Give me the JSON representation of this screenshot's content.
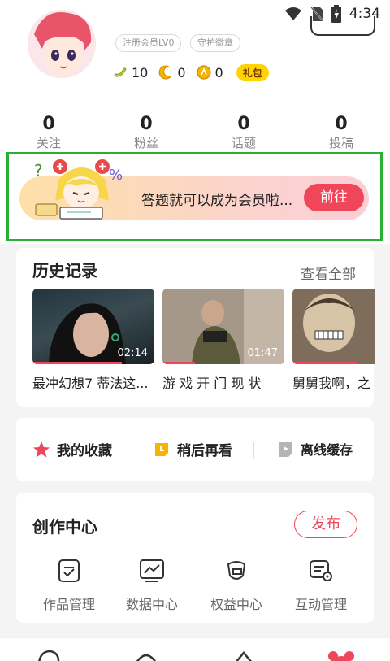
{
  "status_bar": {
    "time": "4:34"
  },
  "profile": {
    "tags": [
      "注册会员LV0",
      "守护徽章"
    ],
    "currencies": [
      {
        "icon": "banana-icon",
        "value": "10"
      },
      {
        "icon": "moon-icon",
        "value": "0"
      },
      {
        "icon": "coin-icon",
        "value": "0"
      }
    ],
    "gift_label": "礼包"
  },
  "stats": [
    {
      "value": "0",
      "label": "关注"
    },
    {
      "value": "0",
      "label": "粉丝"
    },
    {
      "value": "0",
      "label": "话题"
    },
    {
      "value": "0",
      "label": "投稿"
    }
  ],
  "banner": {
    "text": "答题就可以成为会员啦...",
    "button_label": "前往"
  },
  "history": {
    "title": "历史记录",
    "see_all": "查看全部",
    "videos": [
      {
        "title": "最冲幻想7 蒂法这...",
        "duration": "02:14"
      },
      {
        "title": "游 戏 开 门 现 状",
        "duration": "01:47"
      },
      {
        "title": "舅舅我啊，之",
        "duration": ""
      }
    ]
  },
  "quick_actions": [
    {
      "label": "我的收藏",
      "icon": "star-icon"
    },
    {
      "label": "稍后再看",
      "icon": "clock-icon"
    },
    {
      "label": "离线缓存",
      "icon": "download-icon"
    }
  ],
  "creation": {
    "title": "创作中心",
    "publish_label": "发布",
    "tools": [
      {
        "label": "作品管理",
        "icon": "works-icon"
      },
      {
        "label": "数据中心",
        "icon": "chart-icon"
      },
      {
        "label": "权益中心",
        "icon": "rights-icon"
      },
      {
        "label": "互动管理",
        "icon": "interaction-icon"
      }
    ]
  },
  "colors": {
    "accent": "#f0465a",
    "highlight_frame": "#29b033",
    "gold": "#ffd400"
  }
}
